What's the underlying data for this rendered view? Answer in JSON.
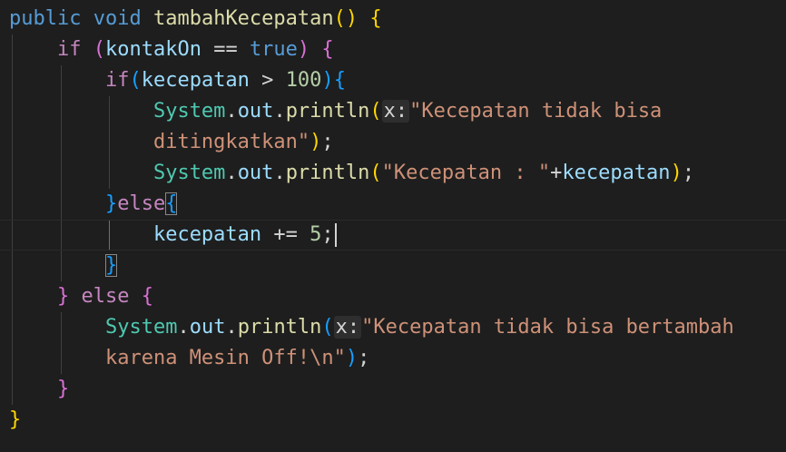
{
  "colors": {
    "background": "#1e1e1e",
    "keyword": "#569cd6",
    "control": "#c586c0",
    "function": "#dcdcaa",
    "variable": "#9cdcfe",
    "class": "#4ec9b0",
    "string": "#ce9178",
    "number": "#b5cea8",
    "bracket1": "#ffd700",
    "bracket2": "#da70d6",
    "bracket3": "#179fff",
    "punctuation": "#d4d4d4"
  },
  "code_lines": [
    {
      "tokens": [
        {
          "t": "public",
          "c": "keyword"
        },
        {
          "t": " "
        },
        {
          "t": "void",
          "c": "keyword"
        },
        {
          "t": " "
        },
        {
          "t": "tambahKecepatan",
          "c": "function"
        },
        {
          "t": "()",
          "c": "bracket1"
        },
        {
          "t": " "
        },
        {
          "t": "{",
          "c": "bracket1"
        }
      ]
    },
    {
      "tokens": [
        {
          "t": "    "
        },
        {
          "t": "if",
          "c": "control"
        },
        {
          "t": " "
        },
        {
          "t": "(",
          "c": "bracket2"
        },
        {
          "t": "kontakOn",
          "c": "variable"
        },
        {
          "t": " == "
        },
        {
          "t": "true",
          "c": "keyword"
        },
        {
          "t": ")",
          "c": "bracket2"
        },
        {
          "t": " "
        },
        {
          "t": "{",
          "c": "bracket2"
        }
      ]
    },
    {
      "tokens": [
        {
          "t": "        "
        },
        {
          "t": "if",
          "c": "control"
        },
        {
          "t": "(",
          "c": "bracket3"
        },
        {
          "t": "kecepatan",
          "c": "variable"
        },
        {
          "t": " > "
        },
        {
          "t": "100",
          "c": "number"
        },
        {
          "t": ")",
          "c": "bracket3"
        },
        {
          "t": "{",
          "c": "bracket3"
        }
      ]
    },
    {
      "tokens": [
        {
          "t": "            "
        },
        {
          "t": "System",
          "c": "class"
        },
        {
          "t": "."
        },
        {
          "t": "out",
          "c": "variable"
        },
        {
          "t": "."
        },
        {
          "t": "println",
          "c": "function"
        },
        {
          "t": "(",
          "c": "bracket1"
        },
        {
          "t": "x:",
          "c": "hint"
        },
        {
          "t": "\"Kecepatan tidak bisa",
          "c": "string"
        }
      ]
    },
    {
      "tokens": [
        {
          "t": "            "
        },
        {
          "t": "ditingkatkan\"",
          "c": "string"
        },
        {
          "t": ")",
          "c": "bracket1"
        },
        {
          "t": ";"
        }
      ]
    },
    {
      "tokens": [
        {
          "t": "            "
        },
        {
          "t": "System",
          "c": "class"
        },
        {
          "t": "."
        },
        {
          "t": "out",
          "c": "variable"
        },
        {
          "t": "."
        },
        {
          "t": "println",
          "c": "function"
        },
        {
          "t": "(",
          "c": "bracket1"
        },
        {
          "t": "\"Kecepatan : \"",
          "c": "string"
        },
        {
          "t": "+"
        },
        {
          "t": "kecepatan",
          "c": "variable"
        },
        {
          "t": ")",
          "c": "bracket1"
        },
        {
          "t": ";"
        }
      ]
    },
    {
      "tokens": [
        {
          "t": "        "
        },
        {
          "t": "}",
          "c": "bracket3"
        },
        {
          "t": "else",
          "c": "control"
        },
        {
          "t": "{",
          "c": "bracket3",
          "match": true
        }
      ]
    },
    {
      "current": true,
      "cursor": true,
      "tokens": [
        {
          "t": "            "
        },
        {
          "t": "kecepatan",
          "c": "variable"
        },
        {
          "t": " += "
        },
        {
          "t": "5",
          "c": "number"
        },
        {
          "t": ";"
        }
      ]
    },
    {
      "tokens": [
        {
          "t": "        "
        },
        {
          "t": "}",
          "c": "bracket3",
          "match": true
        }
      ]
    },
    {
      "tokens": [
        {
          "t": "    "
        },
        {
          "t": "}",
          "c": "bracket2"
        },
        {
          "t": " "
        },
        {
          "t": "else",
          "c": "control"
        },
        {
          "t": " "
        },
        {
          "t": "{",
          "c": "bracket2"
        }
      ]
    },
    {
      "tokens": [
        {
          "t": "        "
        },
        {
          "t": "System",
          "c": "class"
        },
        {
          "t": "."
        },
        {
          "t": "out",
          "c": "variable"
        },
        {
          "t": "."
        },
        {
          "t": "println",
          "c": "function"
        },
        {
          "t": "(",
          "c": "bracket3"
        },
        {
          "t": "x:",
          "c": "hint"
        },
        {
          "t": "\"Kecepatan tidak bisa bertambah",
          "c": "string"
        }
      ]
    },
    {
      "tokens": [
        {
          "t": "        "
        },
        {
          "t": "karena Mesin Off!\\n\"",
          "c": "string"
        },
        {
          "t": ")",
          "c": "bracket3"
        },
        {
          "t": ";"
        }
      ]
    },
    {
      "tokens": [
        {
          "t": "    "
        },
        {
          "t": "}",
          "c": "bracket2"
        }
      ]
    },
    {
      "tokens": [
        {
          "t": "}",
          "c": "bracket1"
        }
      ]
    }
  ]
}
